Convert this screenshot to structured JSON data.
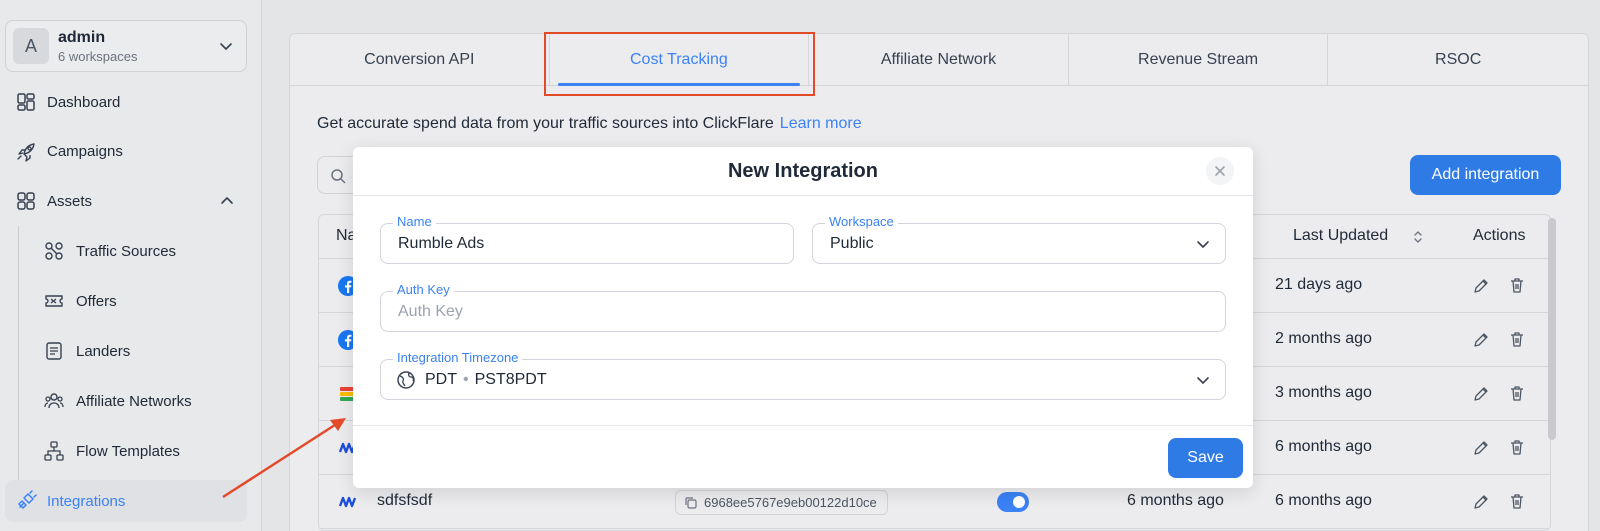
{
  "account": {
    "initial": "A",
    "name": "admin",
    "sub": "6 workspaces"
  },
  "sidebar": {
    "items": [
      {
        "label": "Dashboard",
        "icon": "dashboard-icon"
      },
      {
        "label": "Campaigns",
        "icon": "rocket-icon"
      },
      {
        "label": "Assets",
        "icon": "grid-icon"
      },
      {
        "label": "Traffic Sources",
        "icon": "traffic-icon"
      },
      {
        "label": "Offers",
        "icon": "ticket-icon"
      },
      {
        "label": "Landers",
        "icon": "lander-icon"
      },
      {
        "label": "Affiliate Networks",
        "icon": "users-icon"
      },
      {
        "label": "Flow Templates",
        "icon": "flow-icon"
      },
      {
        "label": "Integrations",
        "icon": "plug-icon",
        "active": true
      }
    ]
  },
  "tabs": [
    "Conversion API",
    "Cost Tracking",
    "Affiliate Network",
    "Revenue Stream",
    "RSOC"
  ],
  "active_tab": "Cost Tracking",
  "description": {
    "text": "Get accurate spend data from your traffic sources into ClickFlare",
    "link": "Learn more"
  },
  "add_button": "Add integration",
  "table": {
    "headers": {
      "name": "Na",
      "last_updated": "Last Updated",
      "actions": "Actions"
    },
    "rows": [
      {
        "last_updated": "21 days ago"
      },
      {
        "last_updated": "2 months ago"
      },
      {
        "last_updated": "3 months ago"
      },
      {
        "last_updated": "6 months ago"
      },
      {
        "name": "sdfsfsdf",
        "id": "6968ee5767e9eb00122d10ce",
        "created": "6 months ago",
        "last_updated": "6 months ago"
      }
    ]
  },
  "modal": {
    "title": "New Integration",
    "name_label": "Name",
    "name_value": "Rumble Ads",
    "workspace_label": "Workspace",
    "workspace_value": "Public",
    "auth_label": "Auth Key",
    "auth_placeholder": "Auth Key",
    "tz_label": "Integration Timezone",
    "tz_abbr": "PDT",
    "tz_sep": "•",
    "tz_name": "PST8PDT",
    "save": "Save"
  },
  "colors": {
    "accent": "#3b82f6",
    "highlight": "#e24a2a"
  }
}
